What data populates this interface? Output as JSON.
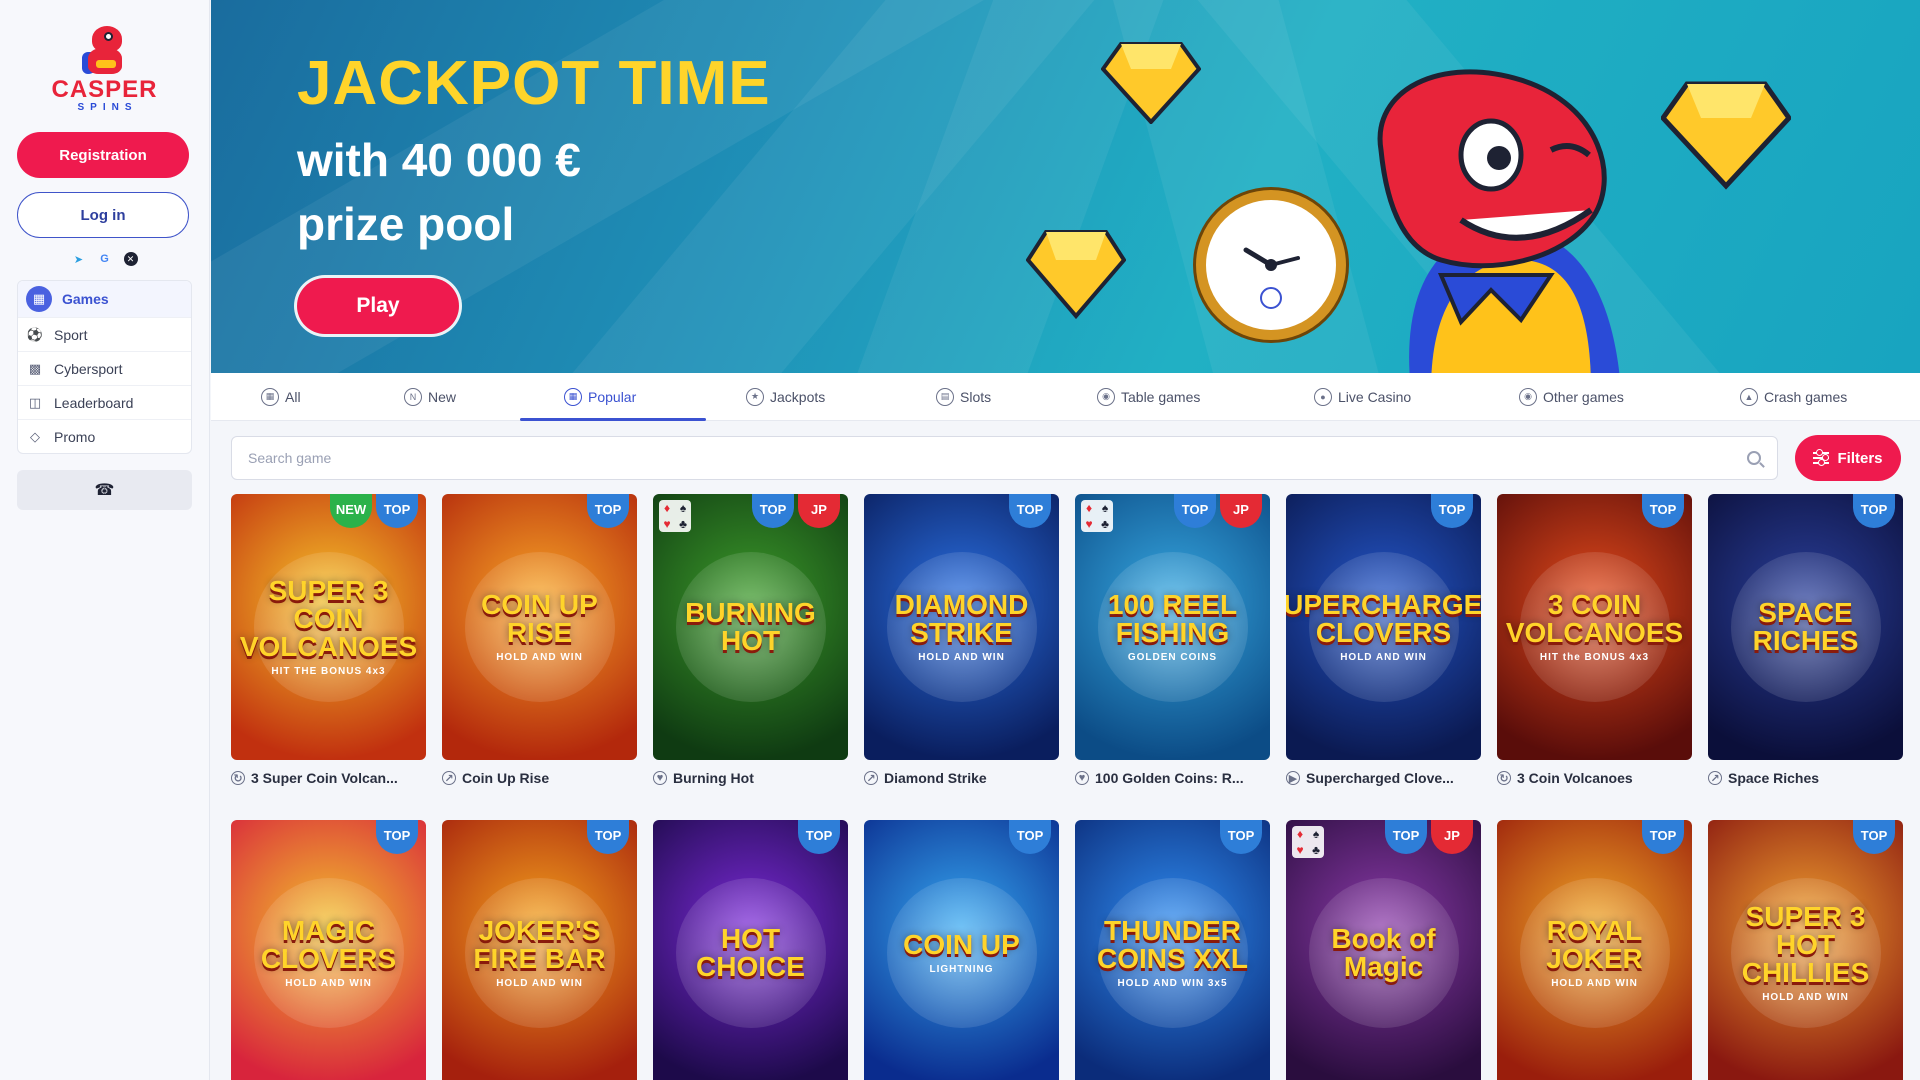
{
  "brand": {
    "name": "CASPER",
    "sub": "SPINS"
  },
  "auth": {
    "register_label": "Registration",
    "login_label": "Log in"
  },
  "socials": [
    "telegram-icon",
    "google-icon",
    "x-icon"
  ],
  "nav": [
    {
      "label": "Games",
      "icon": "games-icon",
      "active": true
    },
    {
      "label": "Sport",
      "icon": "ball-icon"
    },
    {
      "label": "Cybersport",
      "icon": "gamepad-icon"
    },
    {
      "label": "Leaderboard",
      "icon": "leaderboard-icon"
    },
    {
      "label": "Promo",
      "icon": "diamond-icon"
    }
  ],
  "support_icon": "headset-icon",
  "banner": {
    "title": "JACKPOT TIME",
    "line1": "with 40 000 €",
    "line2": "prize pool",
    "play_label": "Play"
  },
  "tabs": [
    {
      "label": "All",
      "icon": "grid-icon"
    },
    {
      "label": "New",
      "icon": "new-icon"
    },
    {
      "label": "Popular",
      "icon": "popular-icon",
      "active": true
    },
    {
      "label": "Jackpots",
      "icon": "jackpot-icon"
    },
    {
      "label": "Slots",
      "icon": "slots-icon"
    },
    {
      "label": "Table games",
      "icon": "table-icon"
    },
    {
      "label": "Live Casino",
      "icon": "live-icon"
    },
    {
      "label": "Other games",
      "icon": "other-icon"
    },
    {
      "label": "Crash games",
      "icon": "crash-icon"
    }
  ],
  "search": {
    "placeholder": "Search game"
  },
  "filters_label": "Filters",
  "badges": {
    "top": "TOP",
    "new": "NEW",
    "jp": "JP"
  },
  "games": [
    {
      "name": "3 Super Coin Volcan...",
      "art": "SUPER 3 COIN VOLCANOES",
      "art_sub": "HIT THE BONUS 4x3",
      "badges": [
        "new",
        "top"
      ],
      "suits": false,
      "bg": [
        "#f6c32a",
        "#c1300f"
      ]
    },
    {
      "name": "Coin Up Rise",
      "art": "COIN UP RISE",
      "art_sub": "HOLD AND WIN",
      "badges": [
        "top"
      ],
      "suits": false,
      "bg": [
        "#f8a627",
        "#b3280c"
      ]
    },
    {
      "name": "Burning Hot",
      "art": "BURNING HOT",
      "art_sub": "",
      "badges": [
        "top",
        "jp"
      ],
      "suits": true,
      "bg": [
        "#3c9a2a",
        "#0f3b12"
      ]
    },
    {
      "name": "Diamond Strike",
      "art": "DIAMOND STRIKE",
      "art_sub": "HOLD AND WIN",
      "badges": [
        "top"
      ],
      "suits": false,
      "bg": [
        "#2a6fe0",
        "#0a1e5e"
      ]
    },
    {
      "name": "100 Golden Coins: R...",
      "art": "100 REEL FISHING",
      "art_sub": "GOLDEN COINS",
      "badges": [
        "top",
        "jp"
      ],
      "suits": true,
      "bg": [
        "#36a7e0",
        "#0c4c86"
      ]
    },
    {
      "name": "Supercharged Clove...",
      "art": "SUPERCHARGED CLOVERS",
      "art_sub": "HOLD AND WIN",
      "badges": [
        "top"
      ],
      "suits": false,
      "bg": [
        "#2456c8",
        "#0b1a52"
      ]
    },
    {
      "name": "3 Coin Volcanoes",
      "art": "3 COIN VOLCANOES",
      "art_sub": "HIT the BONUS 4x3",
      "badges": [
        "top"
      ],
      "suits": false,
      "bg": [
        "#e24a1b",
        "#5a0d0a"
      ]
    },
    {
      "name": "Space Riches",
      "art": "SPACE RICHES",
      "art_sub": "",
      "badges": [
        "top"
      ],
      "suits": false,
      "bg": [
        "#2a3f9a",
        "#0b0f3a"
      ]
    },
    {
      "name": "",
      "art": "MAGIC CLOVERS",
      "art_sub": "HOLD AND WIN",
      "badges": [
        "top"
      ],
      "suits": false,
      "bg": [
        "#f2c12d",
        "#d8243c"
      ]
    },
    {
      "name": "",
      "art": "JOKER'S FIRE BAR",
      "art_sub": "HOLD AND WIN",
      "badges": [
        "top"
      ],
      "suits": false,
      "bg": [
        "#f4a21e",
        "#a5200d"
      ]
    },
    {
      "name": "",
      "art": "HOT CHOICE",
      "art_sub": "",
      "badges": [
        "top"
      ],
      "suits": false,
      "bg": [
        "#7a2ad6",
        "#1d0a4a"
      ]
    },
    {
      "name": "",
      "art": "COIN UP",
      "art_sub": "LIGHTNING",
      "badges": [
        "top"
      ],
      "suits": false,
      "bg": [
        "#36a7f0",
        "#0a2c8e"
      ]
    },
    {
      "name": "",
      "art": "THUNDER COINS XXL",
      "art_sub": "HOLD AND WIN 3x5",
      "badges": [
        "top"
      ],
      "suits": false,
      "bg": [
        "#2f8cf0",
        "#0b2c7a"
      ]
    },
    {
      "name": "",
      "art": "Book of Magic",
      "art_sub": "",
      "badges": [
        "top",
        "jp"
      ],
      "suits": true,
      "bg": [
        "#8a3aa8",
        "#2a0d3e"
      ]
    },
    {
      "name": "",
      "art": "ROYAL JOKER",
      "art_sub": "HOLD AND WIN",
      "badges": [
        "top"
      ],
      "suits": false,
      "bg": [
        "#f0a626",
        "#9a1e0c"
      ]
    },
    {
      "name": "",
      "art": "SUPER 3 HOT CHILLIES",
      "art_sub": "HOLD AND WIN",
      "badges": [
        "top"
      ],
      "suits": false,
      "bg": [
        "#f0a130",
        "#8a1810"
      ]
    }
  ]
}
